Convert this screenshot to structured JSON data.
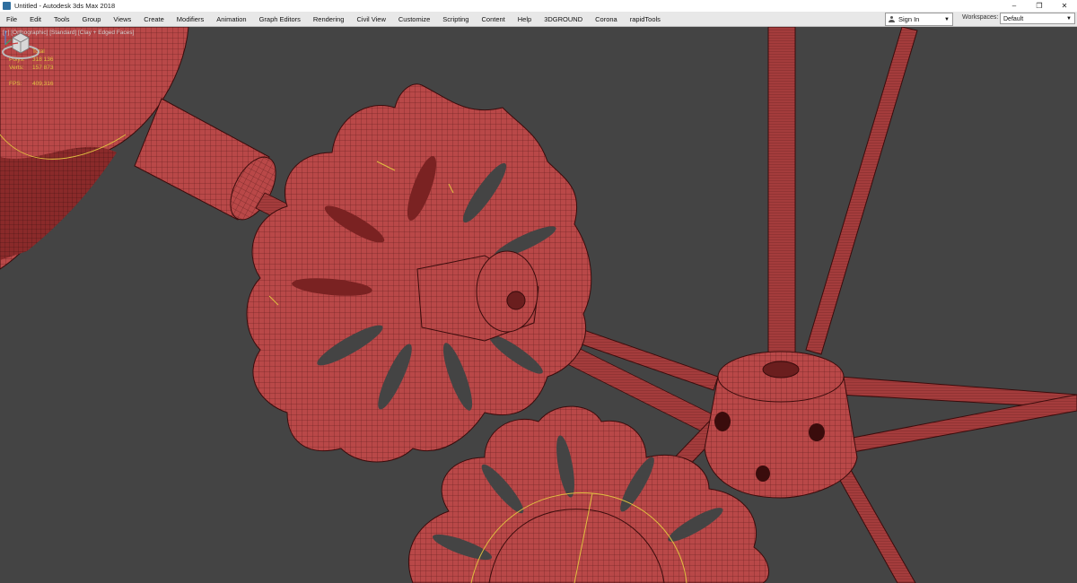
{
  "window": {
    "title": "Untitled - Autodesk 3ds Max 2018",
    "controls": [
      "–",
      "❐",
      "✕"
    ]
  },
  "menu": {
    "items": [
      "File",
      "Edit",
      "Tools",
      "Group",
      "Views",
      "Create",
      "Modifiers",
      "Animation",
      "Graph Editors",
      "Rendering",
      "Civil View",
      "Customize",
      "Scripting",
      "Content",
      "Help",
      "3DGROUND",
      "Corona",
      "rapidTools"
    ]
  },
  "signin": {
    "label": "Sign In",
    "icon": "person-icon"
  },
  "workspaces": {
    "label": "Workspaces:",
    "value": "Default"
  },
  "viewport": {
    "label": "[+] [Orthographic] [Standard] [Clay + Edged Faces]",
    "stats": {
      "header": "Total",
      "polys_label": "Polys:",
      "polys_value": "318 136",
      "verts_label": "Verts:",
      "verts_value": "157 873",
      "fps_label": "FPS:",
      "fps_value": "409,316"
    }
  },
  "colors": {
    "viewport_bg": "#444444",
    "clay_red": "#b94848",
    "wire": "#5a1a1a",
    "stats_yellow": "#e0c040"
  }
}
